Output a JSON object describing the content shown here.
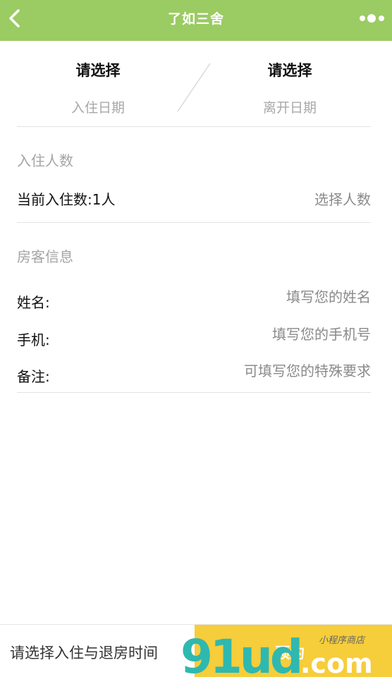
{
  "navbar": {
    "title": "了如三舍",
    "back_icon": "chevron-left-icon",
    "more_icon": "more-dots-icon",
    "color": "#9bcb63"
  },
  "dates": {
    "checkin": {
      "value": "请选择",
      "label": "入住日期"
    },
    "checkout": {
      "value": "请选择",
      "label": "离开日期"
    }
  },
  "guests": {
    "section_title": "入住人数",
    "current": "当前入住数:1人",
    "select_label": "选择人数"
  },
  "guest_info": {
    "section_title": "房客信息",
    "name": {
      "label": "姓名:",
      "placeholder": "填写您的姓名"
    },
    "phone": {
      "label": "手机:",
      "placeholder": "填写您的手机号"
    },
    "note": {
      "label": "备注:",
      "placeholder": "可填写您的特殊要求"
    }
  },
  "bottom": {
    "hint": "请选择入住与退房时间",
    "book_label": "预约",
    "book_color": "#f6cd3a"
  },
  "watermark": {
    "text": "91ud",
    "suffix": ".com",
    "script": "小程序商店"
  }
}
